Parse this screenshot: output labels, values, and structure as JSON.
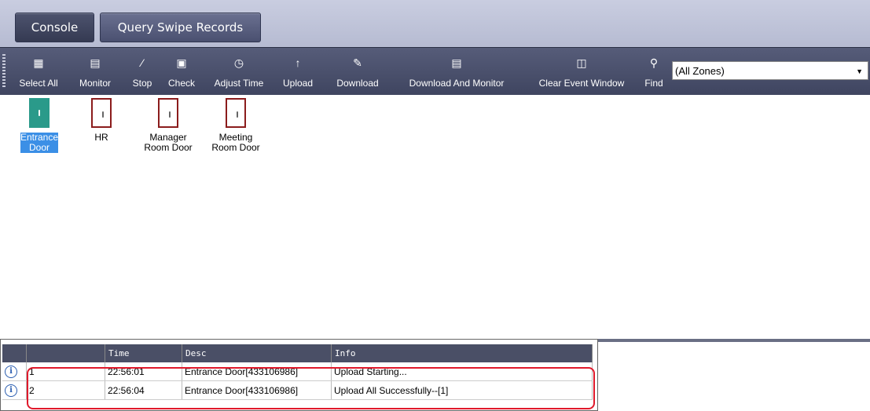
{
  "tabs": [
    {
      "label": "Console"
    },
    {
      "label": "Query Swipe Records"
    }
  ],
  "toolbar": {
    "buttons": [
      {
        "label": "Select All",
        "icon": "select-all-icon"
      },
      {
        "label": "Monitor",
        "icon": "monitor-icon"
      },
      {
        "label": "Stop",
        "icon": "stop-icon"
      },
      {
        "label": "Check",
        "icon": "check-icon"
      },
      {
        "label": "Adjust Time",
        "icon": "clock-icon"
      },
      {
        "label": "Upload",
        "icon": "upload-arrow-icon"
      },
      {
        "label": "Download",
        "icon": "download-icon"
      },
      {
        "label": "Download And Monitor",
        "icon": "download-monitor-icon"
      },
      {
        "label": "Clear Event Window",
        "icon": "trash-icon"
      },
      {
        "label": "Find",
        "icon": "search-icon"
      }
    ],
    "zone_select": {
      "value": "(All Zones)"
    }
  },
  "doors": [
    {
      "name": "Entrance Door",
      "state": "open",
      "selected": true
    },
    {
      "name": "HR",
      "state": "closed",
      "selected": false
    },
    {
      "name": "Manager Room  Door",
      "state": "closed",
      "selected": false
    },
    {
      "name": "Meeting Room Door",
      "state": "closed",
      "selected": false
    }
  ],
  "event_log": {
    "columns": [
      "",
      "",
      "Time",
      "Desc",
      "Info"
    ],
    "rows": [
      {
        "icon": "info-icon",
        "num": "1",
        "time": "22:56:01",
        "desc": "Entrance Door[433106986]",
        "info": "Upload Starting..."
      },
      {
        "icon": "info-icon",
        "num": "2",
        "time": "22:56:04",
        "desc": "Entrance Door[433106986]",
        "info": "Upload All Successfully--[1]"
      }
    ]
  },
  "colors": {
    "door_open": "#2a9a8a",
    "door_closed_border": "#8b1c1c",
    "selected_bg": "#3b8fe6",
    "highlight_border": "#e0192b",
    "toolbar_bg": "#4a5070"
  }
}
